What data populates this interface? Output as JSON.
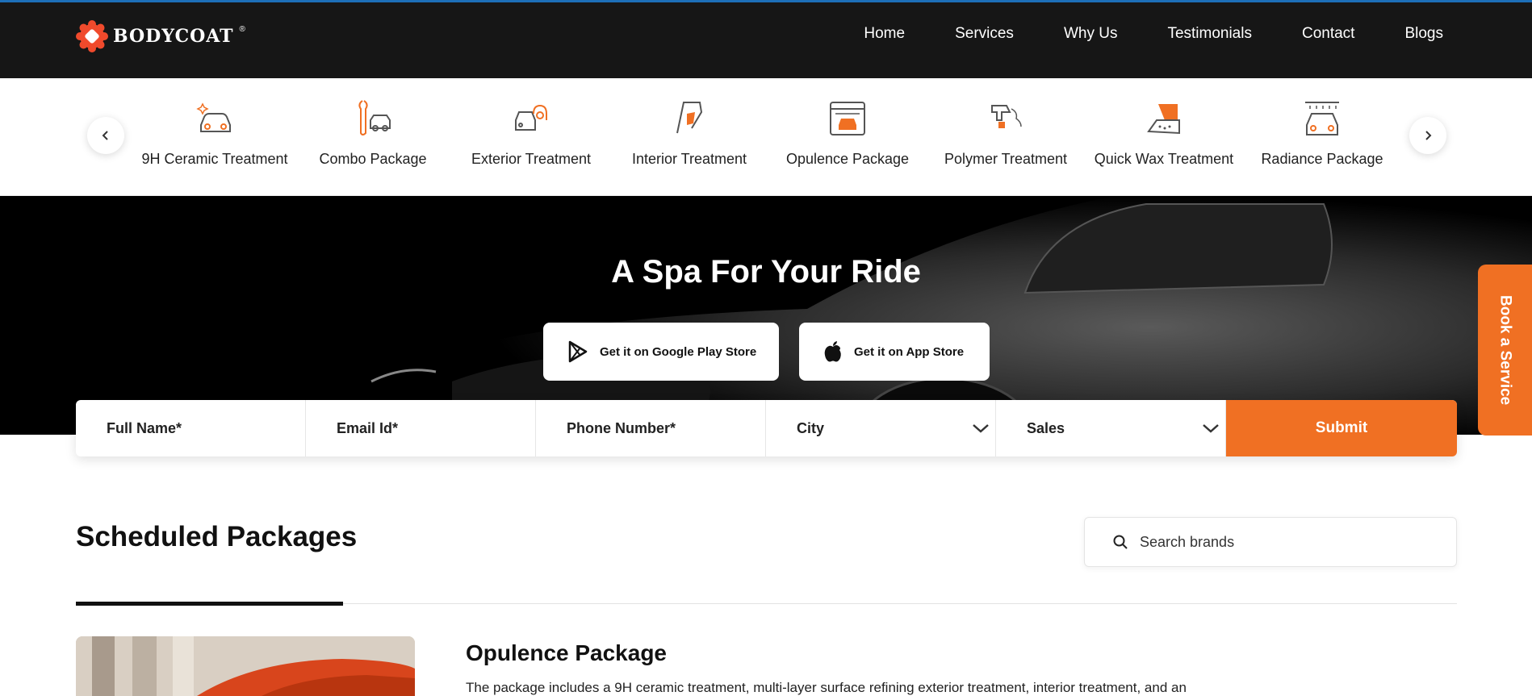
{
  "header": {
    "logo_text": "BODYCOAT",
    "logo_reg": "®",
    "nav": [
      "Home",
      "Services",
      "Why Us",
      "Testimonials",
      "Contact",
      "Blogs"
    ]
  },
  "services": {
    "items": [
      {
        "label": "9H Ceramic Treatment",
        "icon": "car-sparkle-icon"
      },
      {
        "label": "Combo Package",
        "icon": "wrench-car-icon"
      },
      {
        "label": "Exterior Treatment",
        "icon": "car-spray-icon"
      },
      {
        "label": "Interior Treatment",
        "icon": "hand-wipe-icon"
      },
      {
        "label": "Opulence Package",
        "icon": "calendar-car-icon"
      },
      {
        "label": "Polymer Treatment",
        "icon": "spray-gun-icon"
      },
      {
        "label": "Quick Wax Treatment",
        "icon": "wax-hand-icon"
      },
      {
        "label": "Radiance Package",
        "icon": "car-wash-icon"
      }
    ]
  },
  "hero": {
    "title": "A Spa For Your Ride",
    "google_play": "Get it on Google Play Store",
    "app_store": "Get it on App Store"
  },
  "form": {
    "full_name": "Full  Name*",
    "email": "Email Id*",
    "phone": "Phone Number*",
    "city": "City",
    "sales": "Sales",
    "submit": "Submit"
  },
  "side_tab": "Book a Service",
  "scheduled": {
    "title": "Scheduled Packages",
    "search_placeholder": "Search brands",
    "package_title": "Opulence Package",
    "package_desc": "The package includes a 9H ceramic treatment, multi-layer surface refining exterior treatment, interior treatment, and an"
  },
  "colors": {
    "accent": "#f07023",
    "header_bg": "#161616",
    "topline": "#1d6fb8"
  }
}
